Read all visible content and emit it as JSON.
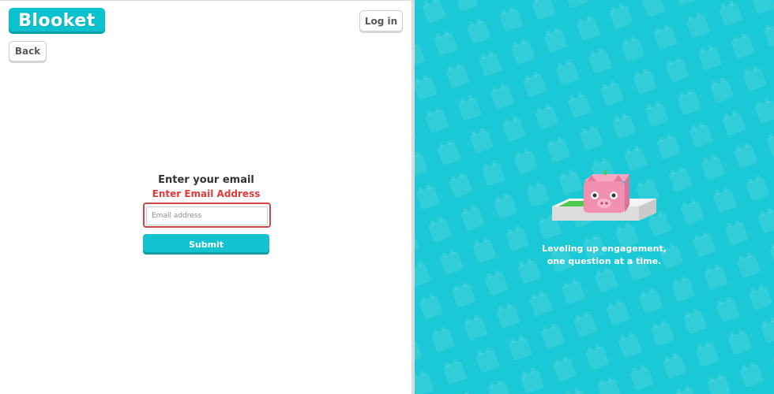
{
  "header": {
    "logo_text": "Blooket",
    "login_label": "Log in",
    "back_label": "Back"
  },
  "form": {
    "title": "Enter your email",
    "error": "Enter Email Address",
    "email_placeholder": "Email address",
    "email_value": "",
    "submit_label": "Submit"
  },
  "promo": {
    "tagline_line1": "Leveling up engagement,",
    "tagline_line2": "one question at a time.",
    "illustration_icon": "pig-blook-icon"
  },
  "colors": {
    "brand": "#0bc2cf",
    "panel_bg": "#1ac8d6",
    "error": "#e03a3a",
    "input_error_border": "#d04646"
  }
}
